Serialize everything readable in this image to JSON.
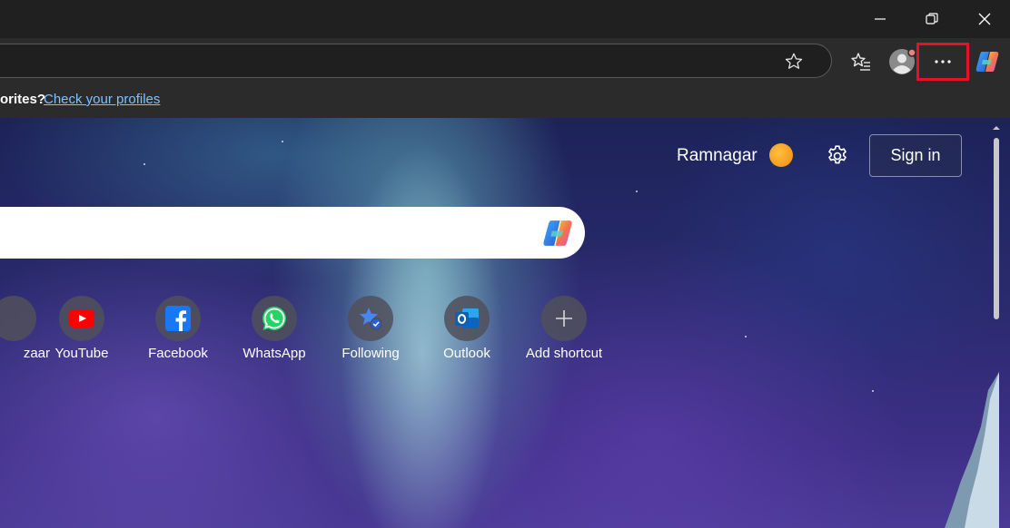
{
  "window": {
    "minimize_label": "Minimize",
    "restore_label": "Restore",
    "close_label": "Close"
  },
  "favorites_bar": {
    "prompt_text": "orites?",
    "link_text": "Check your profiles"
  },
  "new_tab": {
    "location": "Ramnagar",
    "sign_in_label": "Sign in",
    "shortcuts": [
      {
        "label": "zaar",
        "icon": "bazaar-icon"
      },
      {
        "label": "YouTube",
        "icon": "youtube-icon"
      },
      {
        "label": "Facebook",
        "icon": "facebook-icon"
      },
      {
        "label": "WhatsApp",
        "icon": "whatsapp-icon"
      },
      {
        "label": "Following",
        "icon": "following-icon"
      },
      {
        "label": "Outlook",
        "icon": "outlook-icon"
      },
      {
        "label": "Add shortcut",
        "icon": "plus-icon"
      }
    ]
  },
  "colors": {
    "highlight": "#e81123",
    "link": "#7dc2ff",
    "toolbar": "#2b2b2b"
  }
}
